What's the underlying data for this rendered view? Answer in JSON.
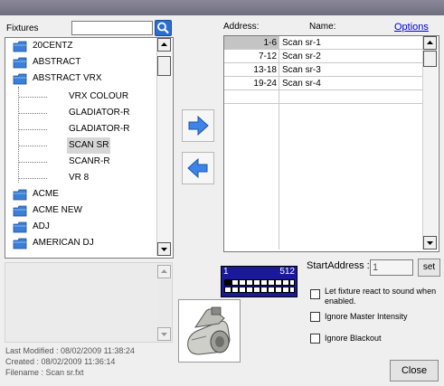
{
  "fixtures": {
    "label": "Fixtures",
    "search_value": "",
    "tree": [
      {
        "label": "20CENTZ",
        "type": "folder"
      },
      {
        "label": "ABSTRACT",
        "type": "folder"
      },
      {
        "label": "ABSTRACT VRX",
        "type": "folder"
      },
      {
        "label": "VRX COLOUR",
        "type": "child"
      },
      {
        "label": "GLADIATOR-R",
        "type": "child"
      },
      {
        "label": "GLADIATOR-R",
        "type": "child"
      },
      {
        "label": "SCAN SR",
        "type": "child",
        "selected": true
      },
      {
        "label": "SCANR-R",
        "type": "child"
      },
      {
        "label": "VR 8",
        "type": "child"
      },
      {
        "label": "ACME",
        "type": "folder"
      },
      {
        "label": "ACME NEW",
        "type": "folder"
      },
      {
        "label": "ADJ",
        "type": "folder"
      },
      {
        "label": "AMERICAN DJ",
        "type": "folder"
      }
    ]
  },
  "patch": {
    "address_header": "Address:",
    "name_header": "Name:",
    "options_label": "Options",
    "rows": [
      {
        "address": "1-6",
        "name": "Scan sr-1"
      },
      {
        "address": "7-12",
        "name": "Scan sr-2"
      },
      {
        "address": "13-18",
        "name": "Scan sr-3"
      },
      {
        "address": "19-24",
        "name": "Scan sr-4"
      }
    ]
  },
  "file_info": {
    "last_modified": "Last Modified : 08/02/2009 11:38:24",
    "created": "Created : 08/02/2009 11:36:14",
    "filename": "Filename : Scan sr.fxt"
  },
  "dmx": {
    "start": "1",
    "end": "512",
    "filled_fraction": 0.0
  },
  "start_address": {
    "label": "StartAddress :",
    "value": "1",
    "set_label": "set"
  },
  "options": {
    "react_sound": "Let fixture react to sound when enabled.",
    "ignore_master": "Ignore Master Intensity",
    "ignore_blackout": "Ignore Blackout"
  },
  "close_label": "Close",
  "colors": {
    "accent_blue": "#2a6fd0",
    "dmx_bar": "#1a1a99",
    "link": "#0000cc"
  }
}
